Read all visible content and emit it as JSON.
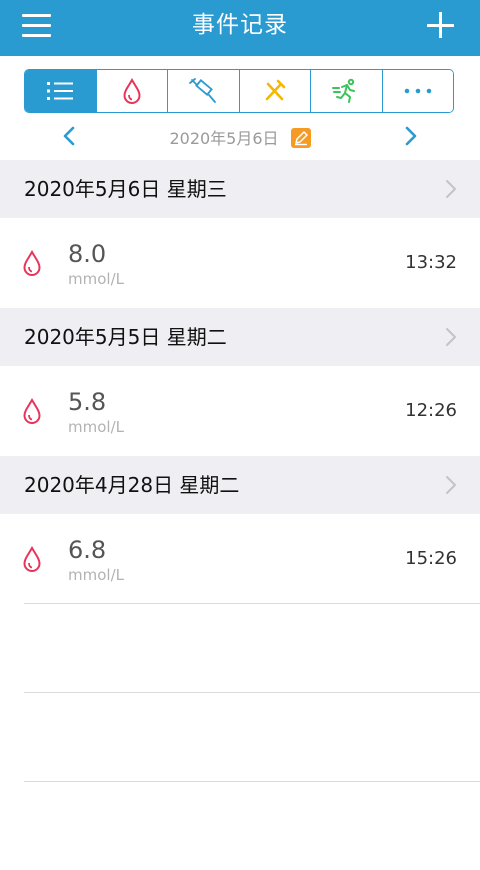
{
  "header": {
    "title": "事件记录",
    "bg_color": "#2a9bd1"
  },
  "filter_tabs": [
    {
      "name": "list",
      "icon": "list-icon",
      "active": true
    },
    {
      "name": "blood-glucose",
      "icon": "blood-drop-icon",
      "active": false
    },
    {
      "name": "insulin",
      "icon": "syringe-icon",
      "active": false
    },
    {
      "name": "diet",
      "icon": "fork-knife-icon",
      "active": false
    },
    {
      "name": "exercise",
      "icon": "running-icon",
      "active": false
    },
    {
      "name": "more",
      "icon": "more-dots-icon",
      "active": false
    }
  ],
  "date_nav": {
    "current_date": "2020年5月6日"
  },
  "days": [
    {
      "header": "2020年5月6日 星期三",
      "entries": [
        {
          "value": "8.0",
          "unit": "mmol/L",
          "time": "13:32"
        }
      ]
    },
    {
      "header": "2020年5月5日 星期二",
      "entries": [
        {
          "value": "5.8",
          "unit": "mmol/L",
          "time": "12:26"
        }
      ]
    },
    {
      "header": "2020年4月28日 星期二",
      "entries": [
        {
          "value": "6.8",
          "unit": "mmol/L",
          "time": "15:26"
        }
      ]
    }
  ],
  "colors": {
    "accent": "#2a9bd1",
    "drop": "#e8345a",
    "insulin": "#2a9bd1",
    "diet": "#f5b800",
    "exercise": "#3cc35a",
    "edit": "#f59b24"
  }
}
